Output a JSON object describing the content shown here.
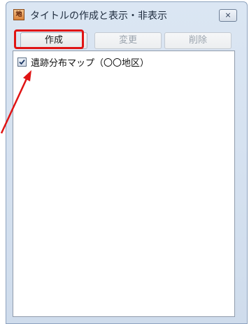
{
  "window": {
    "title": "タイトルの作成と表示・非表示",
    "app_icon_text": "地",
    "close_symbol": "⨯"
  },
  "toolbar": {
    "create_label": "作成",
    "change_label": "変更",
    "delete_label": "削除"
  },
  "list": {
    "items": [
      {
        "label": "遺跡分布マップ（〇〇地区）",
        "checked": true
      }
    ]
  },
  "colors": {
    "highlight": "#e01414",
    "arrow": "#e01414"
  }
}
